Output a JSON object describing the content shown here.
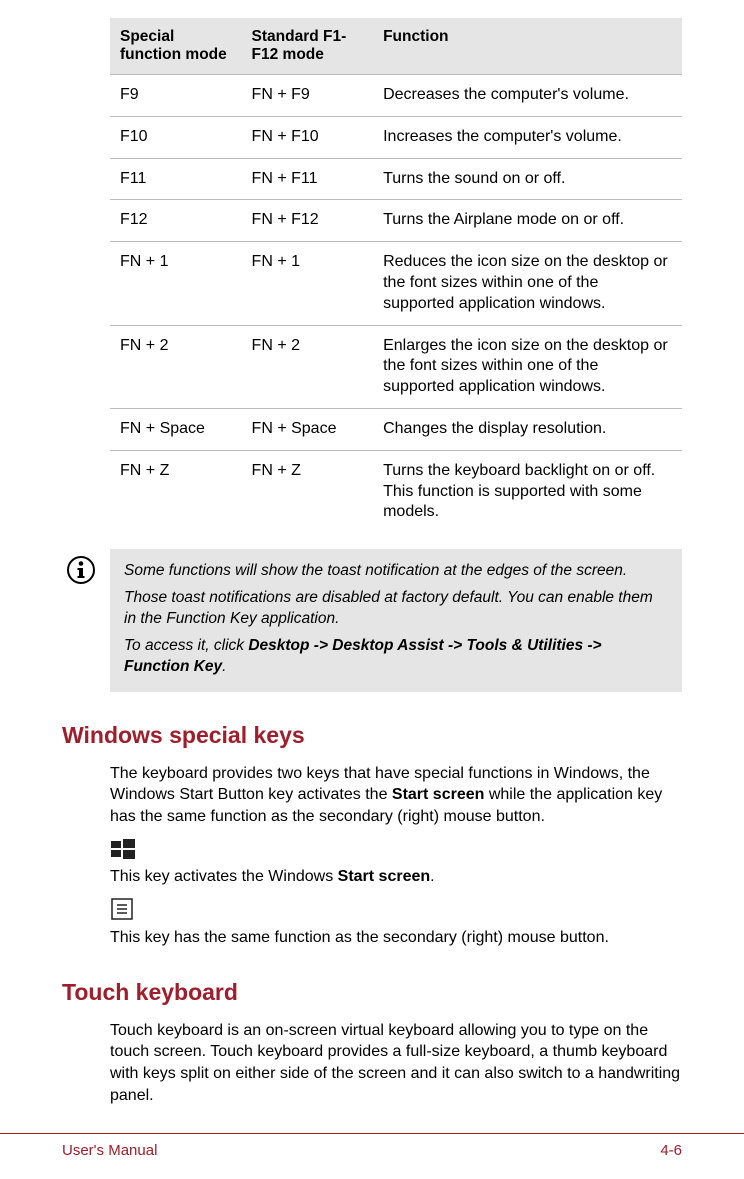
{
  "table": {
    "headers": [
      "Special function mode",
      "Standard F1-F12 mode",
      "Function"
    ],
    "rows": [
      [
        "F9",
        "FN + F9",
        "Decreases the computer's volume."
      ],
      [
        "F10",
        "FN + F10",
        "Increases the computer's volume."
      ],
      [
        "F11",
        "FN + F11",
        "Turns the sound on or off."
      ],
      [
        "F12",
        "FN + F12",
        "Turns the Airplane mode on or off."
      ],
      [
        "FN + 1",
        "FN + 1",
        "Reduces the icon size on the desktop or the font sizes within one of the supported application windows."
      ],
      [
        "FN + 2",
        "FN + 2",
        "Enlarges the icon size on the desktop or the font sizes within one of the supported application windows."
      ],
      [
        "FN + Space",
        "FN + Space",
        "Changes the display resolution."
      ],
      [
        "FN + Z",
        "FN + Z",
        "Turns the keyboard backlight on or off. This function is supported with some models."
      ]
    ]
  },
  "note": {
    "line1": "Some functions will show the toast notification at the edges of the screen.",
    "line2": "Those toast notifications are disabled at factory default. You can enable them in the Function Key application.",
    "line3_prefix": "To access it, click ",
    "line3_bold": "Desktop -> Desktop Assist -> Tools & Utilities -> Function Key",
    "line3_suffix": "."
  },
  "section1": {
    "title": "Windows special keys",
    "para1_a": "The keyboard provides two keys that have special functions in Windows, the Windows Start Button key activates the ",
    "para1_bold": "Start screen",
    "para1_b": " while the application key has the same function as the secondary (right) mouse button.",
    "para2_a": "This key activates the Windows ",
    "para2_bold": "Start screen",
    "para2_b": ".",
    "para3": "This key has the same function as the secondary (right) mouse button."
  },
  "section2": {
    "title": "Touch keyboard",
    "para1": "Touch keyboard is an on-screen virtual keyboard allowing you to type on the touch screen. Touch keyboard provides a full-size keyboard, a thumb keyboard with keys split on either side of the screen and it can also switch to a handwriting panel."
  },
  "footer": {
    "left": "User's Manual",
    "right": "4-6"
  }
}
